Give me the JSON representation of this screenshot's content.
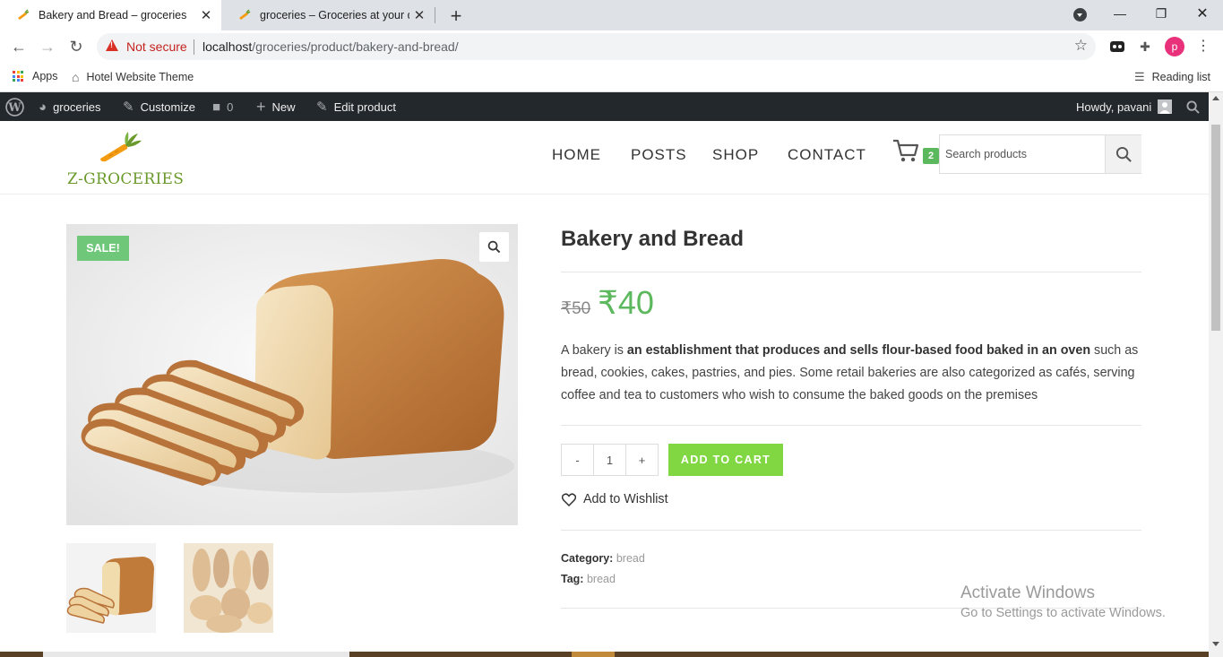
{
  "browser": {
    "tabs": [
      {
        "title": "Bakery and Bread – groceries",
        "active": true
      },
      {
        "title": "groceries – Groceries at your doorstep",
        "active": false
      }
    ],
    "security_label": "Not secure",
    "url_host": "localhost",
    "url_path": "/groceries/product/bakery-and-bread/",
    "profile_initial": "p",
    "bookmarks": [
      {
        "label": "Apps"
      },
      {
        "label": "Hotel Website Theme"
      }
    ],
    "reading_list": "Reading list"
  },
  "admin_bar": {
    "site_name": "groceries",
    "customize": "Customize",
    "comments_count": "0",
    "new_label": "New",
    "edit_label": "Edit product",
    "howdy": "Howdy, pavani"
  },
  "site": {
    "logo_text": "Z-GROCERIES",
    "menu": [
      "HOME",
      "POSTS",
      "SHOP",
      "CONTACT"
    ],
    "cart_count": "2",
    "search_placeholder": "Search products",
    "accent_color": "#81d742",
    "price_color": "#5cb85c"
  },
  "product": {
    "sale_badge": "SALE!",
    "title": "Bakery and Bread",
    "old_price": "₹50",
    "new_price": "₹40",
    "description_prefix": "A bakery is ",
    "description_bold": "an establishment that produces and sells flour-based food baked in an oven",
    "description_suffix": " such as bread, cookies, cakes, pastries, and pies. Some retail bakeries are also categorized as cafés, serving coffee and tea to customers who wish to consume the baked goods on the premises",
    "qty_minus": "-",
    "quantity": "1",
    "qty_plus": "+",
    "add_to_cart": "ADD TO CART",
    "wishlist": "Add to Wishlist",
    "category_label": "Category:",
    "category": "bread",
    "tag_label": "Tag:",
    "tag": "bread"
  },
  "os": {
    "activate_title": "Activate Windows",
    "activate_sub": "Go to Settings to activate Windows."
  }
}
